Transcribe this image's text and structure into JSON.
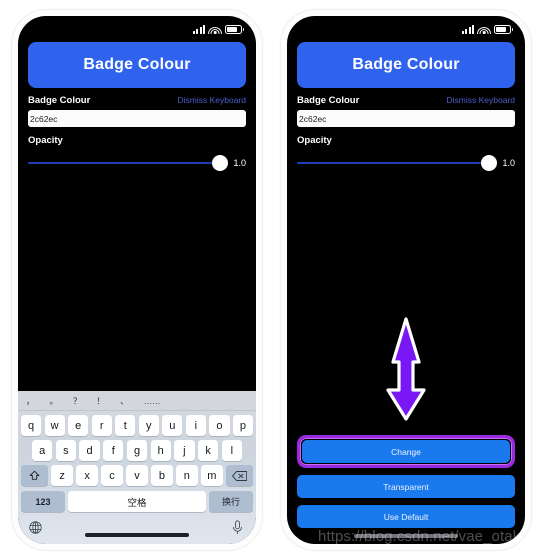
{
  "status_bar": {
    "signal_icon": "cellular-signal-icon",
    "wifi_icon": "wifi-icon",
    "battery_icon": "battery-icon"
  },
  "app": {
    "header_button_label": "Badge Colour",
    "badge_colour_label": "Badge Colour",
    "dismiss_keyboard_label": "Dismiss Keyboard",
    "hex_value": "2c62ec",
    "hex_placeholder": "2c62ec",
    "opacity_label": "Opacity",
    "opacity_value": "1.0"
  },
  "colors": {
    "header_blue": "#2f63ee",
    "action_blue": "#1a7aed",
    "highlight_purple": "#9a2ae0",
    "arrow_purple": "#7a18f5",
    "link_blue": "#4a5fc8",
    "slider_track": "#2040b8",
    "screen_background": "#000000"
  },
  "keyboard": {
    "suggestions": [
      "，",
      "。",
      "？",
      "！",
      "、",
      "……"
    ],
    "row1": [
      "q",
      "w",
      "e",
      "r",
      "t",
      "y",
      "u",
      "i",
      "o",
      "p"
    ],
    "row2": [
      "a",
      "s",
      "d",
      "f",
      "g",
      "h",
      "j",
      "k",
      "l"
    ],
    "row3": [
      "z",
      "x",
      "c",
      "v",
      "b",
      "n",
      "m"
    ],
    "shift_icon": "shift-arrow-icon",
    "backspace_icon": "backspace-icon",
    "numbers_key": "123",
    "space_key": "空格",
    "return_key": "换行",
    "globe_icon": "globe-icon",
    "mic_icon": "microphone-icon"
  },
  "actions": {
    "change_label": "Change",
    "transparent_label": "Transparent",
    "use_default_label": "Use Default"
  },
  "annotation": {
    "arrow_icon": "down-arrow-annotation-icon",
    "highlight_target": "Change"
  },
  "watermark": {
    "text": "https://blog.csdn.net/vae_otaku"
  }
}
